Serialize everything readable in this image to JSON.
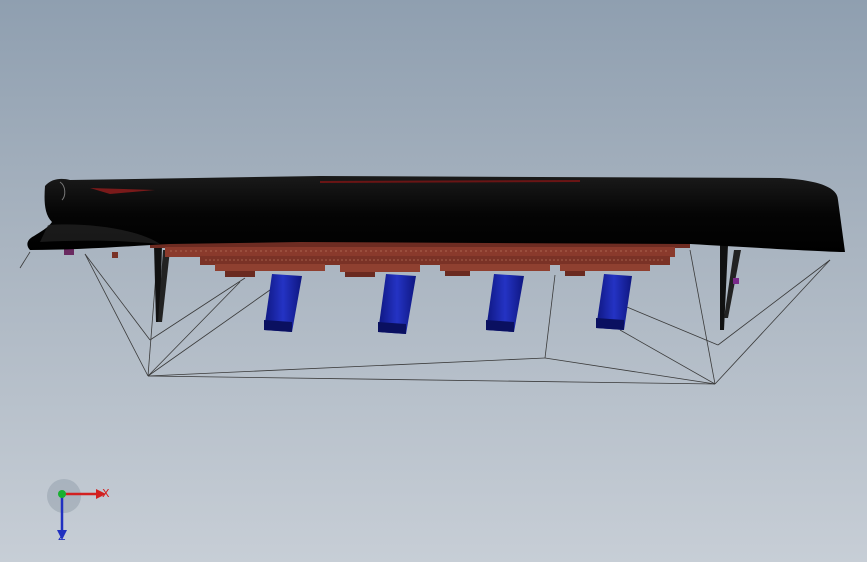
{
  "viewport": {
    "background_top": "#8f9fb0",
    "background_bottom": "#c7ced6"
  },
  "model": {
    "hull_color": "#050505",
    "deck_color": "#8a3a2c",
    "funnel_color": "#1c2aa8",
    "rigging_color": "#3a3a3a",
    "funnel_count": 4
  },
  "triad": {
    "x_label": "X",
    "z_label": "Z",
    "x_color": "#d22020",
    "y_color": "#18b030",
    "z_color": "#2030c0"
  }
}
